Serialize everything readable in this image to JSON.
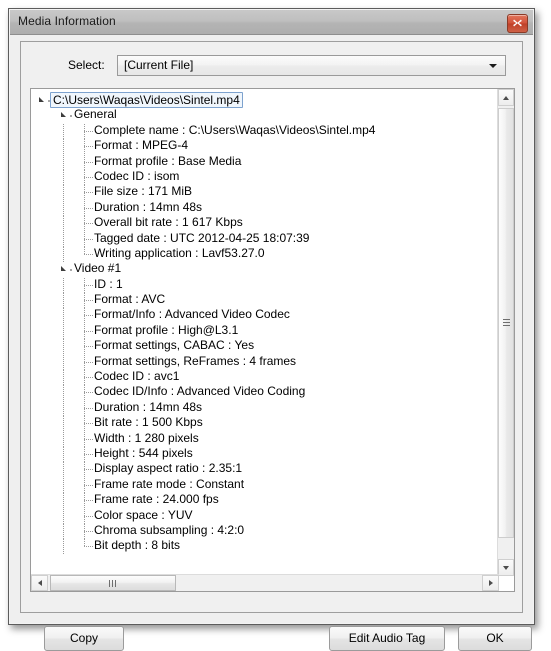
{
  "window": {
    "title": "Media Information",
    "close_icon": "close-icon"
  },
  "select": {
    "label": "Select:",
    "value": "[Current File]",
    "placeholder": "[Current File]",
    "arrow_icon": "chevron-down-icon",
    "options": [
      "[Current File]"
    ]
  },
  "tree": {
    "nodes": [
      {
        "depth": 0,
        "type": "group",
        "selected": true,
        "label": "C:\\Users\\Waqas\\Videos\\Sintel.mp4"
      },
      {
        "depth": 1,
        "type": "group",
        "selected": false,
        "label": "General"
      },
      {
        "depth": 2,
        "type": "leaf",
        "selected": false,
        "label": "Complete name : C:\\Users\\Waqas\\Videos\\Sintel.mp4"
      },
      {
        "depth": 2,
        "type": "leaf",
        "selected": false,
        "label": "Format : MPEG-4"
      },
      {
        "depth": 2,
        "type": "leaf",
        "selected": false,
        "label": "Format profile : Base Media"
      },
      {
        "depth": 2,
        "type": "leaf",
        "selected": false,
        "label": "Codec ID : isom"
      },
      {
        "depth": 2,
        "type": "leaf",
        "selected": false,
        "label": "File size : 171 MiB"
      },
      {
        "depth": 2,
        "type": "leaf",
        "selected": false,
        "label": "Duration : 14mn 48s"
      },
      {
        "depth": 2,
        "type": "leaf",
        "selected": false,
        "label": "Overall bit rate : 1 617 Kbps"
      },
      {
        "depth": 2,
        "type": "leaf",
        "selected": false,
        "label": "Tagged date : UTC 2012-04-25 18:07:39"
      },
      {
        "depth": 2,
        "type": "leaf",
        "selected": false,
        "label": "Writing application : Lavf53.27.0"
      },
      {
        "depth": 1,
        "type": "group",
        "selected": false,
        "label": "Video #1"
      },
      {
        "depth": 2,
        "type": "leaf",
        "selected": false,
        "label": "ID : 1"
      },
      {
        "depth": 2,
        "type": "leaf",
        "selected": false,
        "label": "Format : AVC"
      },
      {
        "depth": 2,
        "type": "leaf",
        "selected": false,
        "label": "Format/Info : Advanced Video Codec"
      },
      {
        "depth": 2,
        "type": "leaf",
        "selected": false,
        "label": "Format profile : High@L3.1"
      },
      {
        "depth": 2,
        "type": "leaf",
        "selected": false,
        "label": "Format settings, CABAC : Yes"
      },
      {
        "depth": 2,
        "type": "leaf",
        "selected": false,
        "label": "Format settings, ReFrames : 4 frames"
      },
      {
        "depth": 2,
        "type": "leaf",
        "selected": false,
        "label": "Codec ID : avc1"
      },
      {
        "depth": 2,
        "type": "leaf",
        "selected": false,
        "label": "Codec ID/Info : Advanced Video Coding"
      },
      {
        "depth": 2,
        "type": "leaf",
        "selected": false,
        "label": "Duration : 14mn 48s"
      },
      {
        "depth": 2,
        "type": "leaf",
        "selected": false,
        "label": "Bit rate : 1 500 Kbps"
      },
      {
        "depth": 2,
        "type": "leaf",
        "selected": false,
        "label": "Width : 1 280 pixels"
      },
      {
        "depth": 2,
        "type": "leaf",
        "selected": false,
        "label": "Height : 544 pixels"
      },
      {
        "depth": 2,
        "type": "leaf",
        "selected": false,
        "label": "Display aspect ratio : 2.35:1"
      },
      {
        "depth": 2,
        "type": "leaf",
        "selected": false,
        "label": "Frame rate mode : Constant"
      },
      {
        "depth": 2,
        "type": "leaf",
        "selected": false,
        "label": "Frame rate : 24.000 fps"
      },
      {
        "depth": 2,
        "type": "leaf",
        "selected": false,
        "label": "Color space : YUV"
      },
      {
        "depth": 2,
        "type": "leaf",
        "selected": false,
        "label": "Chroma subsampling : 4:2:0"
      },
      {
        "depth": 2,
        "type": "leaf",
        "selected": false,
        "label": "Bit depth : 8 bits"
      }
    ]
  },
  "scrollbars": {
    "vertical": {
      "up_icon": "arrow-up-icon",
      "down_icon": "arrow-down-icon",
      "grip_icon": "grip-icon"
    },
    "horizontal": {
      "left_icon": "arrow-left-icon",
      "right_icon": "arrow-right-icon",
      "grip_icon": "grip-icon"
    }
  },
  "buttons": {
    "copy": "Copy",
    "edit_audio_tag": "Edit Audio Tag",
    "ok": "OK"
  },
  "colors": {
    "titlebar": "#bfbfbf",
    "close_button": "#cf5038",
    "selection_border": "#7da2ce",
    "selection_fill": "#f0f6fc",
    "dialog_bg": "#efefef",
    "tree_bg": "#ffffff"
  }
}
